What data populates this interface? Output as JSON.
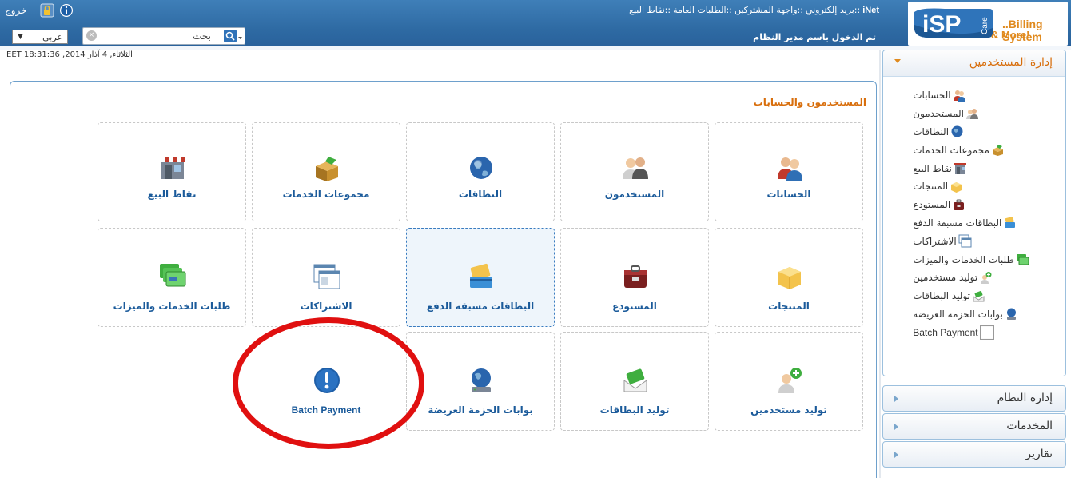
{
  "header": {
    "logout": "خروج",
    "nav": [
      "iNet",
      "::بريد إلكتروني",
      "::واجهة المشتركين",
      "::الطلبات العامة",
      "::نقاط البيع"
    ],
    "welcome": "تم الدخول باسم مدير النظام",
    "language": "عربي",
    "search_label": "بحث",
    "timestamp": "الثلاثاء, 4 آذار 2014, EET 18:31:36",
    "logo_text": "iSP",
    "logo_care": "Care",
    "logo_tagline1": "..Billing System",
    "logo_tagline2": "& More!"
  },
  "main": {
    "title": "المستخدمون والحسابات",
    "tiles": [
      {
        "label": "الحسابات",
        "icon": "users-icon"
      },
      {
        "label": "المستخدمون",
        "icon": "user-icon"
      },
      {
        "label": "النطاقات",
        "icon": "globe-icon"
      },
      {
        "label": "مجموعات الخدمات",
        "icon": "box-icon"
      },
      {
        "label": "نقاط البيع",
        "icon": "store-icon"
      },
      {
        "label": "المنتجات",
        "icon": "product-box-icon"
      },
      {
        "label": "المستودع",
        "icon": "warehouse-icon"
      },
      {
        "label": "البطاقات مسبقة الدفع",
        "icon": "prepaid-card-icon"
      },
      {
        "label": "الاشتراكات",
        "icon": "subscription-window-icon"
      },
      {
        "label": "طلبات الخدمات والميزات",
        "icon": "service-requests-icon"
      },
      {
        "label": "توليد مستخدمين",
        "icon": "add-user-icon"
      },
      {
        "label": "توليد البطاقات",
        "icon": "card-envelope-icon"
      },
      {
        "label": "بوابات الحزمة العريضة",
        "icon": "broadband-gateway-icon"
      },
      {
        "label": "Batch Payment",
        "icon": "exclamation-icon"
      }
    ]
  },
  "sidebar": {
    "sections": [
      {
        "title": "إدارة المستخدمين",
        "expanded": true
      },
      {
        "title": "إدارة النظام",
        "expanded": false
      },
      {
        "title": "المخدمات",
        "expanded": false
      },
      {
        "title": "تقارير",
        "expanded": false
      }
    ],
    "items": [
      {
        "label": "الحسابات",
        "icon": "users-icon"
      },
      {
        "label": "المستخدمون",
        "icon": "user-icon"
      },
      {
        "label": "النطاقات",
        "icon": "globe-icon"
      },
      {
        "label": "مجموعات الخدمات",
        "icon": "box-icon"
      },
      {
        "label": "نقاط البيع",
        "icon": "store-icon"
      },
      {
        "label": "المنتجات",
        "icon": "product-box-icon"
      },
      {
        "label": "المستودع",
        "icon": "warehouse-icon"
      },
      {
        "label": "البطاقات مسبقة الدفع",
        "icon": "prepaid-card-icon"
      },
      {
        "label": "الاشتراكات",
        "icon": "subscription-window-icon"
      },
      {
        "label": "طلبات الخدمات والميزات",
        "icon": "service-requests-icon"
      },
      {
        "label": "توليد مستخدمين",
        "icon": "add-user-icon"
      },
      {
        "label": "توليد البطاقات",
        "icon": "card-envelope-icon"
      },
      {
        "label": "بوابات الحزمة العريضة",
        "icon": "broadband-gateway-icon"
      },
      {
        "label": "Batch Payment",
        "icon": "blank-icon"
      }
    ]
  },
  "colors": {
    "header_blue": "#2e6aa3",
    "accent_orange": "#d86e0c",
    "link_blue": "#1a5a9a",
    "highlight_red": "#e01010"
  }
}
